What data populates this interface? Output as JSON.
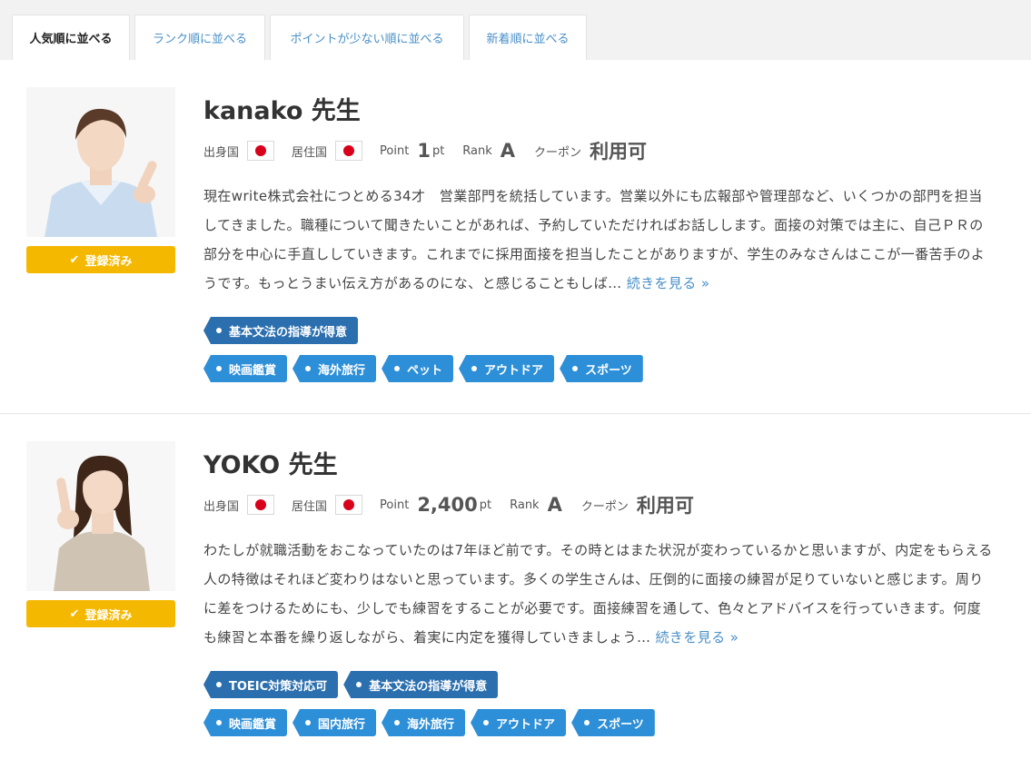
{
  "tabs": [
    {
      "label": "人気順に並べる",
      "active": true
    },
    {
      "label": "ランク順に並べる",
      "active": false
    },
    {
      "label": "ポイントが少ない順に並べる",
      "active": false
    },
    {
      "label": "新着順に並べる",
      "active": false
    }
  ],
  "labels": {
    "origin": "出身国",
    "residence": "居住国",
    "point": "Point",
    "pt_unit": "pt",
    "rank": "Rank",
    "coupon": "クーポン",
    "registered": "登録済み",
    "read_more": "続きを見る »"
  },
  "teachers": [
    {
      "name": "kanako 先生",
      "points": "1",
      "rank": "A",
      "coupon": "利用可",
      "description": "現在write株式会社につとめる34才　営業部門を統括しています。営業以外にも広報部や管理部など、いくつかの部門を担当してきました。職種について聞きたいことがあれば、予約していただければお話しします。面接の対策では主に、自己ＰＲの部分を中心に手直ししていきます。これまでに採用面接を担当したことがありますが、学生のみなさんはここが一番苦手のようです。もっとうまい伝え方があるのにな、と感じることもしば…",
      "tags_primary": [
        "基本文法の指導が得意"
      ],
      "tags_secondary": [
        "映画鑑賞",
        "海外旅行",
        "ペット",
        "アウトドア",
        "スポーツ"
      ]
    },
    {
      "name": "YOKO 先生",
      "points": "2,400",
      "rank": "A",
      "coupon": "利用可",
      "description": "わたしが就職活動をおこなっていたのは7年ほど前です。その時とはまた状況が変わっているかと思いますが、内定をもらえる人の特徴はそれほど変わりはないと思っています。多くの学生さんは、圧倒的に面接の練習が足りていないと感じます。周りに差をつけるためにも、少しでも練習をすることが必要です。面接練習を通して、色々とアドバイスを行っていきます。何度も練習と本番を繰り返しながら、着実に内定を獲得していきましょう…",
      "tags_primary": [
        "TOEIC対策対応可",
        "基本文法の指導が得意"
      ],
      "tags_secondary": [
        "映画鑑賞",
        "国内旅行",
        "海外旅行",
        "アウトドア",
        "スポーツ"
      ]
    }
  ],
  "colors": {
    "accent": "#4a90c8",
    "badge": "#f5b800",
    "tag_dark": "#2b6faf",
    "tag_light": "#2d8fd8",
    "flag_red": "#d8001a"
  }
}
